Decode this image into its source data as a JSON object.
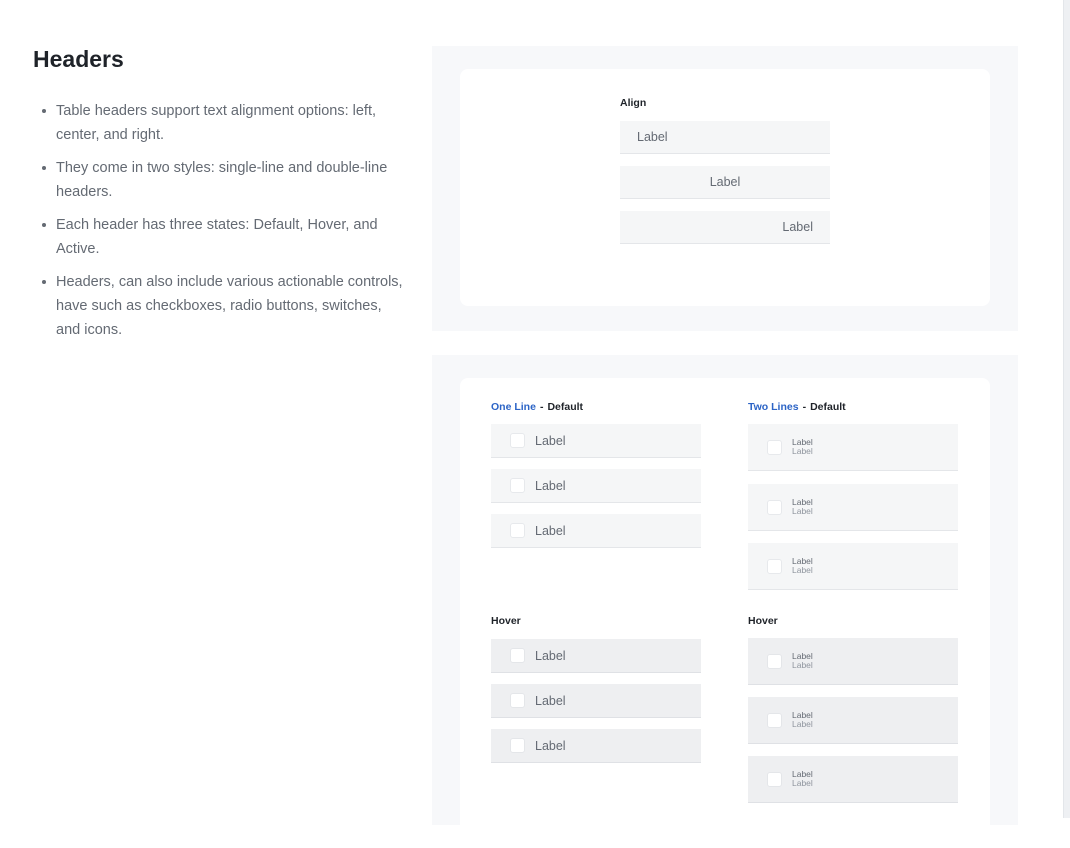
{
  "doc": {
    "title": "Headers",
    "bullets": [
      "Table headers support text alignment options: left, center, and right.",
      "They come in two styles: single-line and double-line headers.",
      "Each header has three states: Default, Hover, and Active.",
      "Headers, can also include various actionable controls, have  such as checkboxes, radio buttons, switches, and icons."
    ]
  },
  "align_demo": {
    "heading": "Align",
    "rows": [
      {
        "label": "Label",
        "align": "left"
      },
      {
        "label": "Label",
        "align": "center"
      },
      {
        "label": "Label",
        "align": "right"
      }
    ]
  },
  "states_demo": {
    "one_line": {
      "title": "One Line",
      "separator": "-",
      "state": "Default",
      "default_rows": [
        "Label",
        "Label",
        "Label"
      ],
      "hover_heading": "Hover",
      "hover_rows": [
        "Label",
        "Label",
        "Label"
      ]
    },
    "two_lines": {
      "title": "Two Lines",
      "separator": "-",
      "state": "Default",
      "default_rows": [
        {
          "primary": "Label",
          "secondary": "Label"
        },
        {
          "primary": "Label",
          "secondary": "Label"
        },
        {
          "primary": "Label",
          "secondary": "Label"
        }
      ],
      "hover_heading": "Hover",
      "hover_rows": [
        {
          "primary": "Label",
          "secondary": "Label"
        },
        {
          "primary": "Label",
          "secondary": "Label"
        },
        {
          "primary": "Label",
          "secondary": "Label"
        }
      ]
    }
  },
  "colors": {
    "accent": "#2c64c6",
    "header_bg": "#f5f6f7",
    "header_hover_bg": "#eeeff1",
    "panel_bg": "#f7f8fa",
    "body_text": "#646a73"
  }
}
